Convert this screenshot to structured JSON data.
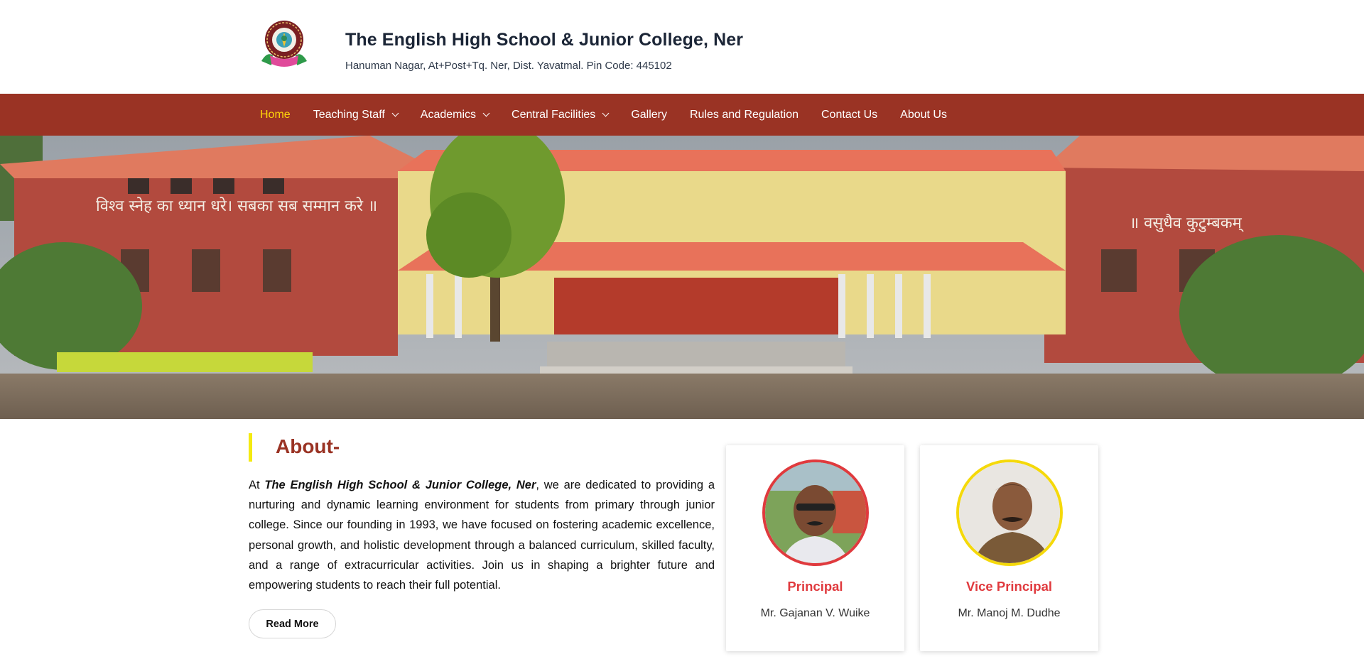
{
  "header": {
    "title": "The English High School & Junior College, Ner",
    "address": "Hanuman Nagar, At+Post+Tq. Ner, Dist. Yavatmal. Pin Code: 445102"
  },
  "nav": {
    "items": [
      {
        "label": "Home",
        "active": true,
        "dropdown": false
      },
      {
        "label": "Teaching Staff",
        "active": false,
        "dropdown": true
      },
      {
        "label": "Academics",
        "active": false,
        "dropdown": true
      },
      {
        "label": "Central Facilities",
        "active": false,
        "dropdown": true
      },
      {
        "label": "Gallery",
        "active": false,
        "dropdown": false
      },
      {
        "label": "Rules and Regulation",
        "active": false,
        "dropdown": false
      },
      {
        "label": "Contact Us",
        "active": false,
        "dropdown": false
      },
      {
        "label": "About Us",
        "active": false,
        "dropdown": false
      }
    ]
  },
  "hero": {
    "wall_text_left": "विश्व स्नेह का ध्यान धरे। सबका सब सम्मान करे ॥",
    "wall_text_right": "॥ वसुधैव कुटुम्बकम्"
  },
  "about": {
    "heading": "About-",
    "intro": "At ",
    "school_name": "The English High School & Junior College, Ner",
    "body": ", we are dedicated to providing a nurturing and dynamic learning environment for students from primary through junior college. Since our founding in 1993, we have focused on fostering academic excellence, personal growth, and holistic development through a balanced curriculum, skilled faculty, and a range of extracurricular activities. Join us in shaping a brighter future and empowering students to reach their full potential.",
    "read_more": "Read More"
  },
  "staff": [
    {
      "role": "Principal",
      "name": "Mr. Gajanan V. Wuike",
      "ring_color": "#e03a3e"
    },
    {
      "role": "Vice Principal",
      "name": "Mr. Manoj M. Dudhe",
      "ring_color": "#f5d90a"
    }
  ],
  "colors": {
    "brand": "#9a3324",
    "nav_active": "#ffd60a",
    "accent_bar": "#f4ea11",
    "role_text": "#e03a3e"
  }
}
